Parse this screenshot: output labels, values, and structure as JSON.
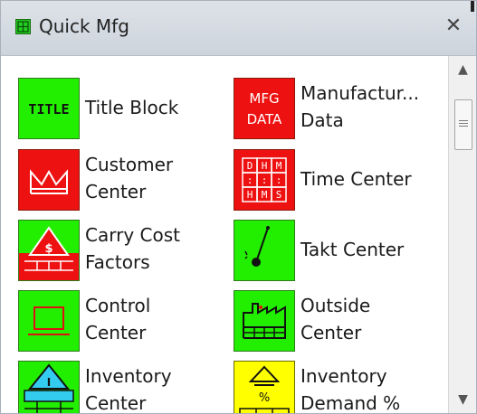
{
  "window": {
    "title": "Quick Mfg",
    "close_glyph": "✕",
    "title_icon": "grid-icon"
  },
  "items": [
    {
      "label": "Title Block",
      "icon": "title-block-icon",
      "icon_text": "TITLE"
    },
    {
      "label": "Manufactur...\nData",
      "icon": "manufacturing-data-icon",
      "icon_text_1": "MFG",
      "icon_text_2": "DATA"
    },
    {
      "label": "Customer\nCenter",
      "icon": "customer-center-icon"
    },
    {
      "label": "Time Center",
      "icon": "time-center-icon",
      "icon_letters": [
        "D",
        "H",
        "M",
        ":",
        ":",
        ":",
        "H",
        "M",
        "S"
      ]
    },
    {
      "label": "Carry Cost\nFactors",
      "icon": "carry-cost-icon",
      "icon_text": "$"
    },
    {
      "label": "Takt Center",
      "icon": "takt-center-icon"
    },
    {
      "label": "Control\nCenter",
      "icon": "control-center-icon"
    },
    {
      "label": "Outside\nCenter",
      "icon": "outside-center-icon"
    },
    {
      "label": "Inventory\nCenter",
      "icon": "inventory-center-icon",
      "icon_text": "I"
    },
    {
      "label": "Inventory\nDemand %",
      "icon": "inventory-demand-icon",
      "icon_text": "%"
    }
  ],
  "scrollbar": {
    "up_glyph": "▲",
    "down_glyph": "▼"
  },
  "colors": {
    "green": "#22ee00",
    "red": "#ee1111",
    "yellow": "#ffff00",
    "cyan": "#33ccee"
  }
}
